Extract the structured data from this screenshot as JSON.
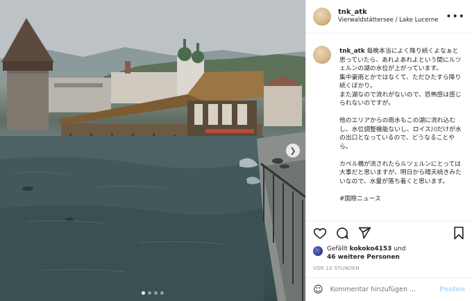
{
  "post": {
    "username": "tnk_atk",
    "location": "Vierwaldstättersee / Lake Lucerne",
    "more_icon": "more-horizontal-icon",
    "caption_user": "tnk_atk",
    "caption_text": " 毎晩本当によく降り続くよなぁと思っていたら、あれよあれよという間にルツェルンの湖の水位が上がっています。\n集中豪雨とかではなくて、ただひたすら降り続くばかり。\nまた湖なので流れがないので、恐怖感は感じられないのですが。\n\n他のエリアからの雨水もこの湖に流れ込むし、水位調整機能ないし、ロイス川だけが水の出口となっているので、どうなることやら。\n\nカペル橋が流されたらルツェルンにとっては大事だと思いますが、明日から晴天続きみたいなので、水量が落ち着くと思います。\n\n#国際ニュース",
    "liked_by_prefix": "Gefällt",
    "liked_by_user": "kokoko4153",
    "liked_by_and": "und",
    "liked_by_others": "46 weitere Personen",
    "timestamp": "VOR 10 STUNDEN",
    "comment_placeholder": "Kommentar hinzufügen ...",
    "post_button": "Posten"
  },
  "carousel": {
    "total_slides": 4,
    "active_slide": 1,
    "next_icon": "chevron-right-icon"
  },
  "icons": {
    "like": "heart-icon",
    "comment": "comment-icon",
    "share": "paper-plane-icon",
    "save": "bookmark-icon",
    "emoji": "smiley-icon"
  },
  "colors": {
    "post_button_disabled": "#b3dbff",
    "meta_gray": "#8e8e8e",
    "text": "#262626"
  }
}
